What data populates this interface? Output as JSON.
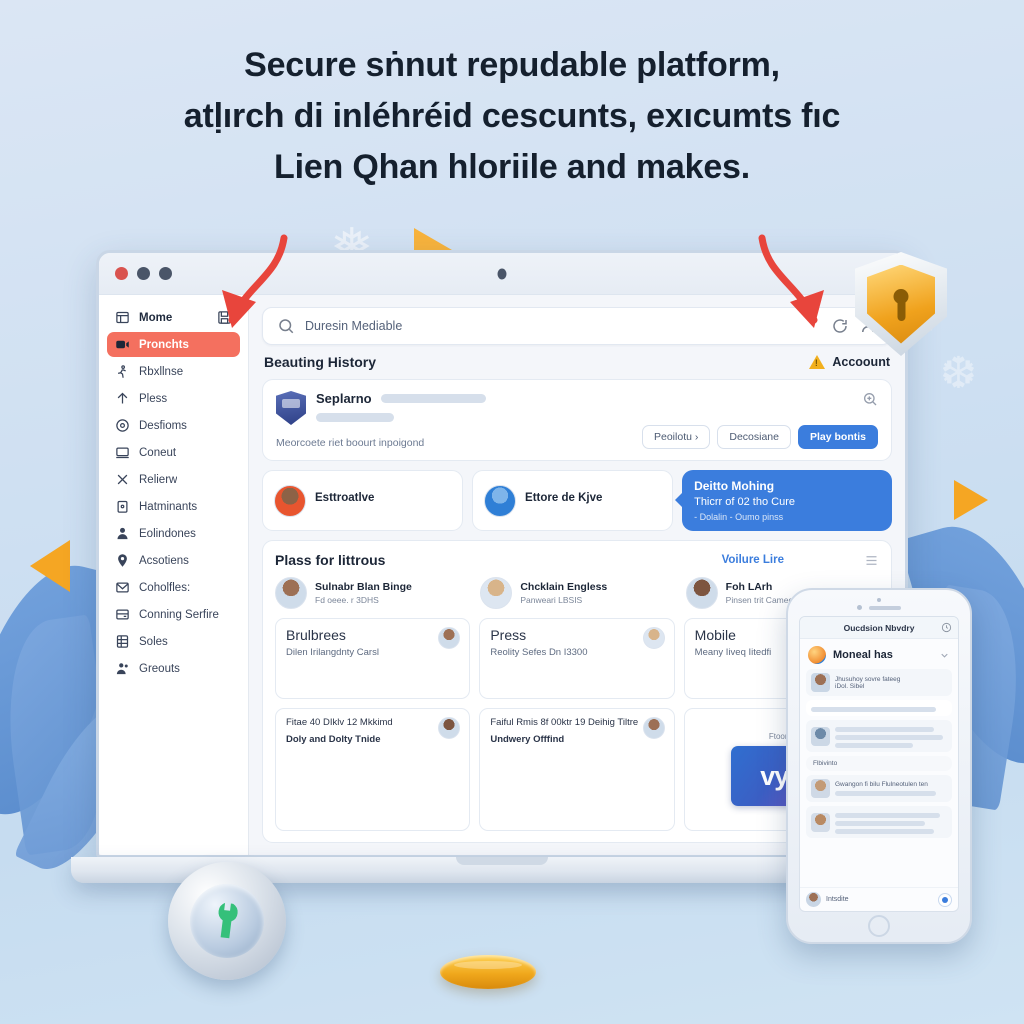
{
  "headline": {
    "line1": "Secure sṅnut repudable platform,",
    "line2": "atḷırch di inléhréid cescunts, exıcumts fıc",
    "line3": "Lien Qhan hloriile and makes."
  },
  "browser": {
    "window_controls": [
      "close",
      "minimize",
      "maximize"
    ],
    "camera": "camera-dot"
  },
  "sidebar": {
    "items": [
      {
        "label": "Mome",
        "icon": "layout-icon",
        "trailing": "save-icon",
        "active": false
      },
      {
        "label": "Pronchts",
        "icon": "video-icon",
        "active": true
      },
      {
        "label": "Rbxllnse",
        "icon": "person-run-icon",
        "active": false
      },
      {
        "label": "Pless",
        "icon": "arrow-up-icon",
        "active": false
      },
      {
        "label": "Desfioms",
        "icon": "circle-icon",
        "active": false
      },
      {
        "label": "Coneut",
        "icon": "monitor-icon",
        "active": false
      },
      {
        "label": "Relierw",
        "icon": "close-x-icon",
        "active": false
      },
      {
        "label": "Hatminants",
        "icon": "lock-icon",
        "active": false
      },
      {
        "label": "Eolindones",
        "icon": "user-icon",
        "active": false
      },
      {
        "label": "Acsotiens",
        "icon": "pin-icon",
        "active": false
      },
      {
        "label": "Coholfles:",
        "icon": "envelope-icon",
        "active": false
      },
      {
        "label": "Conning Serfire",
        "icon": "card-icon",
        "active": false
      },
      {
        "label": "Soles",
        "icon": "grid-icon",
        "active": false
      },
      {
        "label": "Greouts",
        "icon": "user-group-icon",
        "active": false
      }
    ]
  },
  "search": {
    "query": "Duresin Mediable",
    "icon": "search-icon",
    "refresh_icon": "refresh-icon",
    "account_icon": "account-icon"
  },
  "section": {
    "title": "Beauting History",
    "account_label": "Accoount",
    "warning_icon": "warning-triangle-icon"
  },
  "hero": {
    "name": "Seplarno",
    "subtitle": "Meorcoete riet boourt inpoigond",
    "crest_icon": "shield-crest-icon",
    "expand_icon": "zoom-in-icon",
    "buttons": [
      {
        "label": "Peoilotu ›",
        "style": "ghost"
      },
      {
        "label": "Decosiane",
        "style": "ghost"
      },
      {
        "label": "Play bontis",
        "style": "primary"
      }
    ]
  },
  "chips": [
    {
      "name": "Esttroatlve",
      "avatar": "avatar-orange"
    },
    {
      "name": "Ettore de Kjve",
      "avatar": "avatar-blue"
    }
  ],
  "callout": {
    "line1": "Deitto Mohing",
    "line2": "Thicrr of 02 tho Cure",
    "line3": "- Dolalin - Oumo pinss"
  },
  "panel": {
    "title": "Plass for littrous",
    "link": "Voilure Lire",
    "corner_icon": "list-icon",
    "people": [
      {
        "name": "Sulnabr Blan Binge",
        "meta": "Fd oeee. r 3DHS"
      },
      {
        "name": "Chcklain Engless",
        "meta": "Panweari LBSIS"
      },
      {
        "name": "Foh LArh",
        "meta": "Pinsen trit Cameo Hit"
      }
    ],
    "tiles_row1": [
      {
        "title": "Brulbrees",
        "sub": "Dilen Irilangdnty Carsl"
      },
      {
        "title": "Press",
        "sub": "Reolity Sefes Dn I3300"
      },
      {
        "title": "Mobile",
        "sub": "Meany Iiveq Iitedfi"
      }
    ],
    "tiles_row2": [
      {
        "line1": "Fitae 40 DIklv 12 Mkkimd",
        "line2": "Doly and Dolty Tnide"
      },
      {
        "line1": "Faiful Rmis 8f 00ktr 19 Deihig Tiltre",
        "line2": "Undwery Offfind"
      }
    ],
    "vyx": {
      "caption": "Ftoone",
      "logo": "vyx"
    }
  },
  "phone": {
    "header": "Oucdsion Nbvdry",
    "clock_icon": "clock-icon",
    "title": "Moneal has",
    "chevron_icon": "chevron-down-icon",
    "rows": [
      {
        "text": "Jhusuhoy sovre fateeg",
        "sub": "iDol. Sibel"
      },
      {
        "text": ""
      },
      {
        "text": ""
      },
      {
        "pill": "Flbivinto"
      },
      {
        "text": "Gwangon fi bilu Flulneotulen ten"
      },
      {
        "text": ""
      }
    ],
    "footer": {
      "label": "Intsdite",
      "action_icon": "compose-icon"
    }
  },
  "badges": {
    "shield": {
      "name": "security-shield-badge",
      "icon": "keyhole-icon",
      "color": "#f0a21d"
    },
    "medal": {
      "name": "service-medal-badge",
      "icon": "wrench-icon",
      "color": "#35c07a"
    },
    "coin": {
      "name": "gold-coin",
      "color": "#f0a81c"
    }
  },
  "annotations": {
    "arrow_left": "red-arrow-annotation",
    "arrow_right": "red-arrow-annotation"
  },
  "decor": {
    "triangles": [
      "orange-triangle",
      "orange-triangle",
      "orange-triangle"
    ],
    "leaves": [
      "blue-leaf",
      "blue-leaf",
      "blue-leaf",
      "blue-leaf",
      "blue-leaf"
    ],
    "snowflakes": [
      "❅",
      "❄",
      "❆"
    ]
  }
}
